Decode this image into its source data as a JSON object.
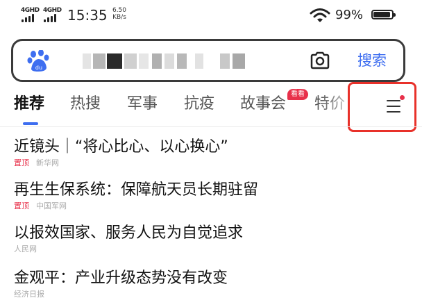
{
  "status_bar": {
    "network_1": "4GHD",
    "network_2": "4GHD",
    "time": "15:35",
    "speed_value": "6.50",
    "speed_unit": "KB/s",
    "battery": "99%",
    "battery_level": 0.99,
    "icons": [
      "signal-icon",
      "signal-icon",
      "wifi-icon",
      "battery-icon"
    ]
  },
  "search": {
    "logo_icon": "baidu-paw-icon",
    "camera_icon": "camera-icon",
    "button_label": "搜索",
    "accent": "#3e6ef0"
  },
  "tabs": {
    "items": [
      {
        "label": "推荐",
        "active": true
      },
      {
        "label": "热搜"
      },
      {
        "label": "军事"
      },
      {
        "label": "抗疫"
      },
      {
        "label": "故事会",
        "badge": "看看"
      },
      {
        "label": "特价"
      }
    ],
    "menu_icon": "menu-icon"
  },
  "highlight_color": "#e8312a",
  "news": [
    {
      "title": "近镜头｜“将心比心、以心换心”",
      "pin": "置顶",
      "source": "新华网"
    },
    {
      "title": "再生生保系统：保障航天员长期驻留",
      "pin": "置顶",
      "source": "中国军网"
    },
    {
      "title": "以报效国家、服务人民为自觉追求",
      "pin": "",
      "source": "人民网"
    },
    {
      "title": "金观平：产业升级态势没有改变",
      "pin": "",
      "source": "经济日报"
    }
  ]
}
